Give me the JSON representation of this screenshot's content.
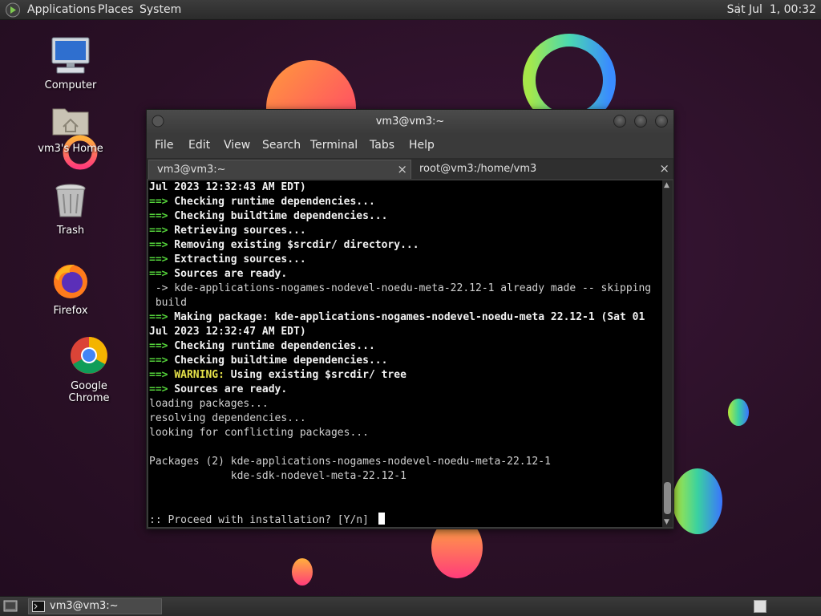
{
  "top_panel": {
    "menus": [
      "Applications",
      "Places",
      "System"
    ],
    "clock": "Sat Jul  1, 00:32"
  },
  "desktop": {
    "icons": [
      {
        "label": "Computer",
        "icon": "computer-icon"
      },
      {
        "label": "vm3's Home",
        "icon": "home-folder-icon"
      },
      {
        "label": "Trash",
        "icon": "trash-icon"
      },
      {
        "label": "Firefox",
        "icon": "firefox-icon"
      },
      {
        "label": "Google Chrome",
        "icon": "chrome-icon"
      }
    ]
  },
  "window": {
    "title": "vm3@vm3:~",
    "menus": [
      "File",
      "Edit",
      "View",
      "Search",
      "Terminal",
      "Tabs",
      "Help"
    ],
    "tabs": [
      {
        "label": "vm3@vm3:~",
        "active": true,
        "close": "×"
      },
      {
        "label": "root@vm3:/home/vm3",
        "active": false,
        "close": "×"
      }
    ]
  },
  "terminal": {
    "lines": [
      {
        "arrow": "",
        "text": "Jul 2023 12:32:43 AM EDT)",
        "bold": true
      },
      {
        "arrow": "==>",
        "text": " Checking runtime dependencies...",
        "bold": true
      },
      {
        "arrow": "==>",
        "text": " Checking buildtime dependencies...",
        "bold": true
      },
      {
        "arrow": "==>",
        "text": " Retrieving sources...",
        "bold": true
      },
      {
        "arrow": "==>",
        "text": " Removing existing $srcdir/ directory...",
        "bold": true
      },
      {
        "arrow": "==>",
        "text": " Extracting sources...",
        "bold": true
      },
      {
        "arrow": "==>",
        "text": " Sources are ready.",
        "bold": true
      },
      {
        "arrow": "",
        "text": " -> kde-applications-nogames-nodevel-noedu-meta-22.12-1 already made -- skipping",
        "bold": false
      },
      {
        "arrow": "",
        "text": " build",
        "bold": false
      },
      {
        "arrow": "==>",
        "text": " Making package: kde-applications-nogames-nodevel-noedu-meta 22.12-1 (Sat 01",
        "bold": true
      },
      {
        "arrow": "",
        "text": "Jul 2023 12:32:47 AM EDT)",
        "bold": true
      },
      {
        "arrow": "==>",
        "text": " Checking runtime dependencies...",
        "bold": true
      },
      {
        "arrow": "==>",
        "text": " Checking buildtime dependencies...",
        "bold": true
      },
      {
        "arrow": "==>",
        "warn": "WARNING:",
        "text": " Using existing $srcdir/ tree",
        "bold": true
      },
      {
        "arrow": "==>",
        "text": " Sources are ready.",
        "bold": true
      },
      {
        "arrow": "",
        "text": "loading packages...",
        "bold": false
      },
      {
        "arrow": "",
        "text": "resolving dependencies...",
        "bold": false
      },
      {
        "arrow": "",
        "text": "looking for conflicting packages...",
        "bold": false
      },
      {
        "arrow": "",
        "text": "",
        "bold": false
      },
      {
        "arrow": "",
        "text": "Packages (2) kde-applications-nogames-nodevel-noedu-meta-22.12-1",
        "bold": false
      },
      {
        "arrow": "",
        "text": "             kde-sdk-nodevel-meta-22.12-1",
        "bold": false
      },
      {
        "arrow": "",
        "text": "",
        "bold": false
      },
      {
        "arrow": "",
        "text": "",
        "bold": false
      },
      {
        "arrow": "",
        "text": ":: Proceed with installation? [Y/n] ",
        "bold": false,
        "cursor": true
      }
    ]
  },
  "bottom_panel": {
    "task": "vm3@vm3:~"
  },
  "colors": {
    "arrow": "#55d43b",
    "warning": "#e6e24a",
    "desktop_bg": "#2a1026"
  }
}
